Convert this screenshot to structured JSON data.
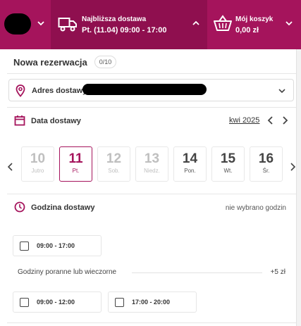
{
  "header": {
    "delivery": {
      "title": "Najbliższa dostawa",
      "slot": "Pt. (11.04) 09:00 - 17:00"
    },
    "cart": {
      "title": "Mój koszyk",
      "total": "0,00 zł"
    }
  },
  "reservation": {
    "title": "Nowa rezerwacja",
    "counter": "0/10",
    "address_label": "Adres dostawy",
    "date_label": "Data dostawy",
    "month": "kwi 2025",
    "days": [
      {
        "num": "10",
        "label": "Jutro",
        "state": "disabled"
      },
      {
        "num": "11",
        "label": "Pt.",
        "state": "selected"
      },
      {
        "num": "12",
        "label": "Sob.",
        "state": "disabled"
      },
      {
        "num": "13",
        "label": "Niedz.",
        "state": "disabled"
      },
      {
        "num": "14",
        "label": "Pon.",
        "state": "enabled"
      },
      {
        "num": "15",
        "label": "Wt.",
        "state": "enabled"
      },
      {
        "num": "16",
        "label": "Śr.",
        "state": "enabled"
      }
    ],
    "hour_label": "Godzina dostawy",
    "hour_status": "nie wybrano godzin",
    "slots_standard": [
      "09:00 - 17:00"
    ],
    "group_label": "Godziny poranne lub wieczorne",
    "group_price": "+5 zł",
    "slots_extra": [
      "09:00 - 12:00",
      "17:00 - 20:00"
    ]
  },
  "colors": {
    "brand": "#a5145c",
    "brand_dark": "#8f0f4f"
  }
}
